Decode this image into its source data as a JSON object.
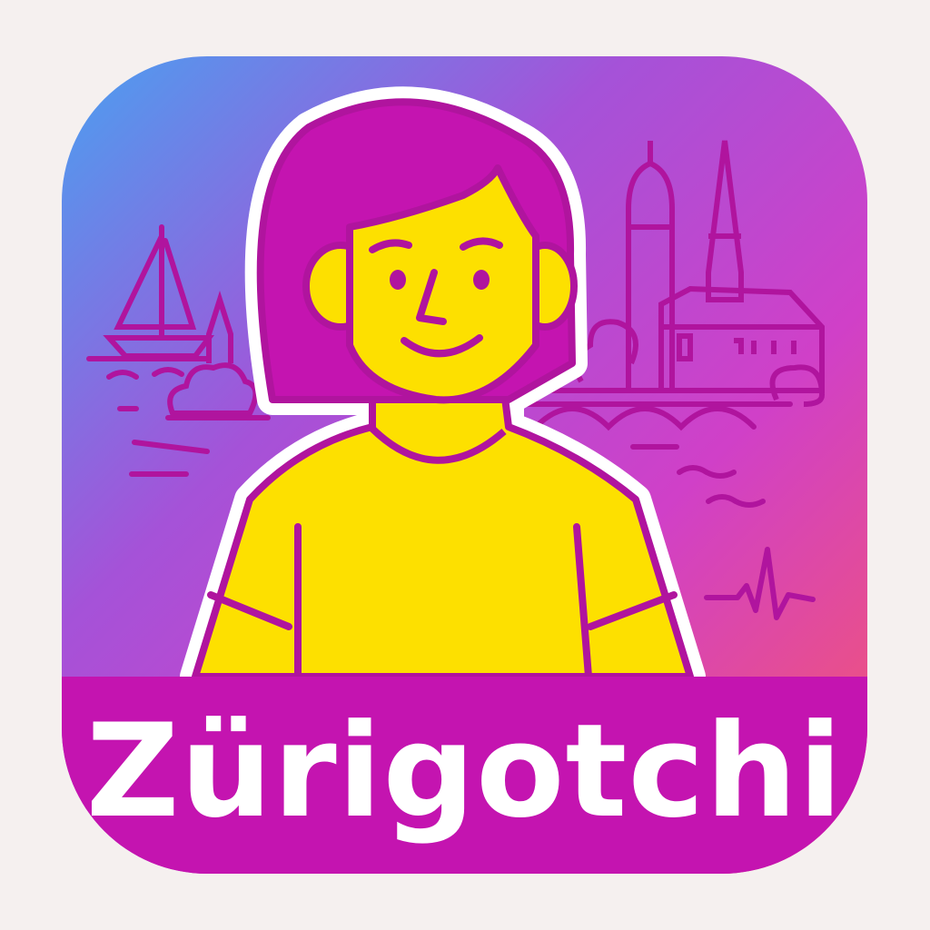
{
  "app": {
    "name": "Zürigotchi"
  },
  "colors": {
    "gradient_top_left": "#4aa0f0",
    "gradient_top_right": "#a552d8",
    "gradient_mid": "#d040c8",
    "gradient_bottom_right": "#f6586a",
    "banner": "#c414b0",
    "line": "#b0149e",
    "skin": "#fde000",
    "background": "#f5f0ef"
  },
  "icons": [
    "sailboat-icon",
    "church-icon",
    "bridge-icon",
    "tree-icon",
    "heartbeat-icon",
    "person-avatar"
  ]
}
